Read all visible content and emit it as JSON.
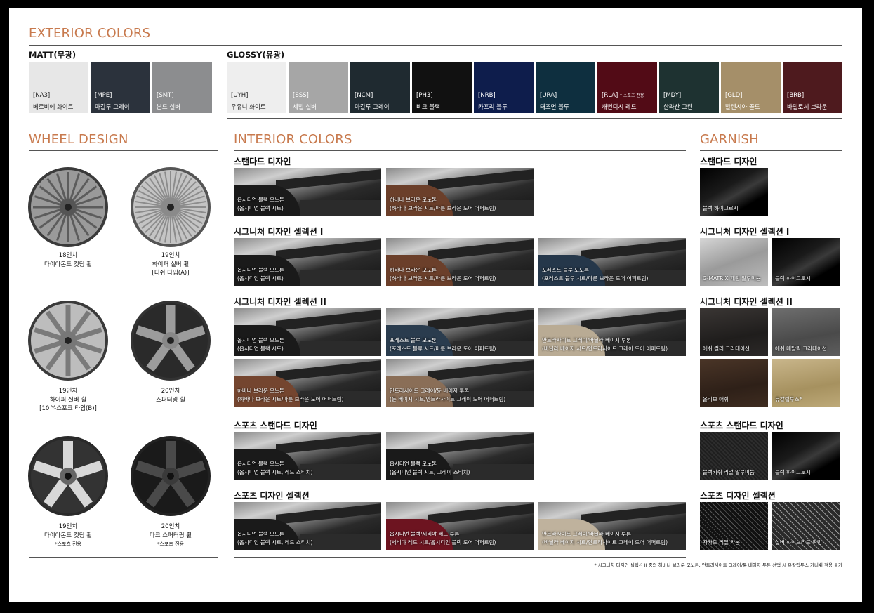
{
  "exterior": {
    "title": "EXTERIOR COLORS",
    "matt_label": "MATT(무광)",
    "glossy_label": "GLOSSY(유광)",
    "matt": [
      {
        "code": "[NA3]",
        "name": "베르비에 화이트",
        "color": "#e7e7e7",
        "text_color": "#222222"
      },
      {
        "code": "[MPE]",
        "name": "마칼루 그레이",
        "color": "#2b323c",
        "text_color": "#ffffff"
      },
      {
        "code": "[SMT]",
        "name": "본드 실버",
        "color": "#8c8d8f",
        "text_color": "#ffffff"
      }
    ],
    "glossy": [
      {
        "code": "[UYH]",
        "name": "우유니 화이트",
        "color": "#eeeeee",
        "text_color": "#222222"
      },
      {
        "code": "[SSS]",
        "name": "세빌 실버",
        "color": "#a6a6a6",
        "text_color": "#ffffff"
      },
      {
        "code": "[NCM]",
        "name": "마칼루 그레이",
        "color": "#1f2a30",
        "text_color": "#ffffff"
      },
      {
        "code": "[PH3]",
        "name": "비크 블랙",
        "color": "#111111",
        "text_color": "#ffffff"
      },
      {
        "code": "[NRB]",
        "name": "카프리 블루",
        "color": "#0e1d4c",
        "text_color": "#ffffff"
      },
      {
        "code": "[URA]",
        "name": "태즈먼 블루",
        "color": "#0e2f3f",
        "text_color": "#ffffff"
      },
      {
        "code": "[RLA]",
        "code_note": "* 스포츠 전용",
        "name": "캐번디시 레드",
        "color": "#520b16",
        "text_color": "#ffffff"
      },
      {
        "code": "[MDY]",
        "name": "한라산 그린",
        "color": "#1e3231",
        "text_color": "#ffffff"
      },
      {
        "code": "[GLD]",
        "name": "발렌시아 골드",
        "color": "#a58f69",
        "text_color": "#ffffff"
      },
      {
        "code": "[BRB]",
        "name": "바릴로체 브라운",
        "color": "#4e1a1e",
        "text_color": "#ffffff"
      }
    ]
  },
  "wheel": {
    "title": "WHEEL DESIGN",
    "items": [
      {
        "l1": "18인치",
        "l2": "다이아몬드 컷팅 휠",
        "l3": ""
      },
      {
        "l1": "19인치",
        "l2": "하이퍼 실버 휠",
        "l3": "[디쉬 타입(A)]"
      },
      {
        "l1": "19인치",
        "l2": "하이퍼 실버 휠",
        "l3": "[10 Y-스포크 타입(B)]"
      },
      {
        "l1": "20인치",
        "l2": "스퍼터링 휠",
        "l3": ""
      },
      {
        "l1": "19인치",
        "l2": "다이아몬드 컷팅 휠",
        "l3": "*스포츠 전용"
      },
      {
        "l1": "20인치",
        "l2": "다크 스퍼터링 휠",
        "l3": "*스포츠 전용"
      }
    ]
  },
  "interior": {
    "title": "INTERIOR COLORS",
    "groups": [
      {
        "title": "스탠다드 디자인",
        "items": [
          {
            "l1": "옵시디언 블랙 모노톤",
            "l2": "(옵시디언 블랙 시트)",
            "seat": "#1a1a1a"
          },
          {
            "l1": "하바나 브라운 모노톤",
            "l2": "(하바나 브라운 시트/마룬 브라운 도어 어퍼트림)",
            "seat": "#6b3f2a"
          }
        ]
      },
      {
        "title": "시그니처 디자인 셀렉션 I",
        "items": [
          {
            "l1": "옵시디언 블랙 모노톤",
            "l2": "(옵시디언 블랙 시트)",
            "seat": "#1a1a1a"
          },
          {
            "l1": "하바나 브라운 모노톤",
            "l2": "(하바나 브라운 시트/마룬 브라운 도어 어퍼트림)",
            "seat": "#6b3f2a"
          },
          {
            "l1": "포레스트 블루 모노톤",
            "l2": "(포레스트 블루 시트/마룬 브라운 도어 어퍼트림)",
            "seat": "#25374a"
          }
        ]
      },
      {
        "title": "시그니처 디자인 셀렉션 II",
        "items": [
          {
            "l1": "옵시디언 블랙 모노톤",
            "l2": "(옵시디언 블랙 시트)",
            "seat": "#1a1a1a"
          },
          {
            "l1": "포레스트 블루 모노톤",
            "l2": "(포레스트 블루 시트/마룬 브라운 도어 어퍼트림)",
            "seat": "#2a3c4e"
          },
          {
            "l1": "안트라사이트 그레이/바닐라 베이지 투톤",
            "l2": "(바닐라 베이지 시트/안트라사이트 그레이 도어 어퍼트림)",
            "seat": "#b9ab94"
          },
          {
            "l1": "하바나 브라운 모노톤",
            "l2": "(하바나 브라운 시트/마룬 브라운 도어 어퍼트림)",
            "seat": "#74452f"
          },
          {
            "l1": "안트라사이트 그레이/듄 베이지 투톤",
            "l2": "(듄 베이지 시트/안트라사이트 그레이 도어 어퍼트림)",
            "seat": "#8a6e57"
          }
        ]
      },
      {
        "title": "스포츠 스탠다드 디자인",
        "items": [
          {
            "l1": "옵시디언 블랙 모노톤",
            "l2": "(옵시디언 블랙 시트, 레드 스티치)",
            "seat": "#1a1a1a"
          },
          {
            "l1": "옵시디언 블랙 모노톤",
            "l2": "(옵시디언 블랙 시트, 그레이 스티치)",
            "seat": "#1a1a1a"
          }
        ]
      },
      {
        "title": "스포츠 디자인 셀렉션",
        "items": [
          {
            "l1": "옵시디언 블랙 모노톤",
            "l2": "(옵시디언 블랙 시트, 레드 스티치)",
            "seat": "#1a1a1a"
          },
          {
            "l1": "옵시디언 블랙/세비야 레드 투톤",
            "l2": "(세비야 레드 시트/옵시디언 블랙 도어 어퍼트림)",
            "seat": "#6d1420"
          },
          {
            "l1": "안트라사이트 그레이/바닐라 베이지 투톤",
            "l2": "(바닐라 베이지 시트/안트라사이트 그레이 도어 어퍼트림)",
            "seat": "#bfb29d"
          }
        ]
      }
    ]
  },
  "garnish": {
    "title": "GARNISH",
    "groups": [
      {
        "title": "스탠다드 디자인",
        "items": [
          {
            "label": "블랙 하이그로시",
            "bg": "linear-gradient(150deg,#000 0%,#1a1a1a 40%,#3a3a3a 55%,#000 75%)"
          }
        ]
      },
      {
        "title": "시그니처 디자인 셀렉션 I",
        "items": [
          {
            "label": "G-MATRIX 패턴 알루미늄",
            "bg": "linear-gradient(160deg,#d6d6d6 0%,#9a9a9a 50%,#bdbdbd 100%)"
          },
          {
            "label": "블랙 하이그로시",
            "bg": "linear-gradient(150deg,#000 0%,#1a1a1a 40%,#3a3a3a 55%,#000 75%)"
          }
        ]
      },
      {
        "title": "시그니처 디자인 셀렉션 II",
        "items": [
          {
            "label": "애쉬 컬러 그라데이션",
            "bg": "linear-gradient(170deg,#3a3634 0%,#1f1d1c 60%,#2c2928 100%)"
          },
          {
            "label": "애쉬 메탈릭 그라데이션",
            "bg": "linear-gradient(170deg,#6e6e6e 0%,#4a4a4a 60%,#5e5e5e 100%)"
          },
          {
            "label": "올리브 애쉬",
            "bg": "linear-gradient(170deg,#4a3527 0%,#2e2018 60%,#3e2c20 100%)"
          },
          {
            "label": "유칼립투스*",
            "bg": "linear-gradient(170deg,#c9b68b 0%,#a6915f 60%,#bda978 100%)"
          }
        ]
      },
      {
        "title": "스포츠 스탠다드 디자인",
        "items": [
          {
            "label": "블랙키쉬 리얼 알루미늄",
            "bg": "repeating-linear-gradient(45deg,#1e1e1e 0px,#1e1e1e 2px,#2d2d2d 2px,#2d2d2d 4px)"
          },
          {
            "label": "블랙 하이그로시",
            "bg": "linear-gradient(150deg,#000 0%,#1a1a1a 40%,#3a3a3a 55%,#000 75%)"
          }
        ]
      },
      {
        "title": "스포츠 디자인 셀렉션",
        "items": [
          {
            "label": "자카드 리얼 카본",
            "bg": "repeating-linear-gradient(45deg,#111 0px,#111 4px,#555 4px,#555 5px),#222"
          },
          {
            "label": "실버 하이브리드 위빙",
            "bg": "repeating-linear-gradient(45deg,#2a2a2a 0px,#2a2a2a 5px,#9a9a9a 5px,#9a9a9a 6px)"
          }
        ]
      }
    ]
  },
  "footnote": "* 시그니처 디자인 셀렉션 II 중의 하바나 브라운 모노톤, 안트라사이트 그레이/듄 베이지 투톤 선택 시 유칼립투스 가니쉬 적용 불가"
}
